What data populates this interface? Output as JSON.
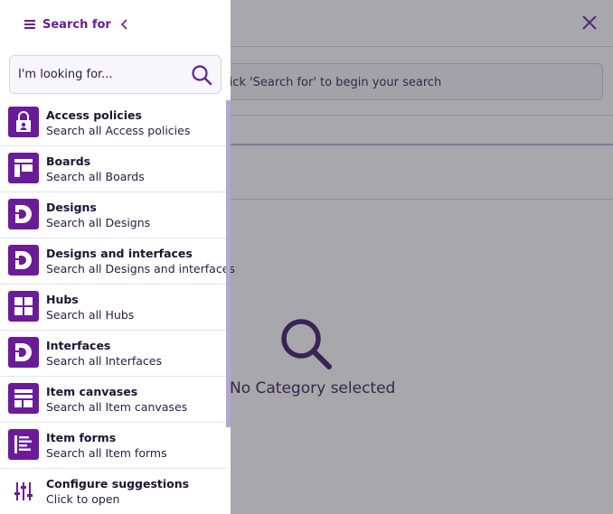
{
  "panel": {
    "title": "Search for",
    "search_placeholder": "I'm looking for..."
  },
  "categories": [
    {
      "title": "Access policies",
      "subtitle": "Search all Access policies",
      "icon": "lock-icon"
    },
    {
      "title": "Boards",
      "subtitle": "Search all Boards",
      "icon": "board-icon"
    },
    {
      "title": "Designs",
      "subtitle": "Search all Designs",
      "icon": "design-icon"
    },
    {
      "title": "Designs and interfaces",
      "subtitle": "Search all Designs and interfaces",
      "icon": "design-icon"
    },
    {
      "title": "Hubs",
      "subtitle": "Search all Hubs",
      "icon": "grid-icon"
    },
    {
      "title": "Interfaces",
      "subtitle": "Search all Interfaces",
      "icon": "design-icon"
    },
    {
      "title": "Item canvases",
      "subtitle": "Search all Item canvases",
      "icon": "canvas-icon"
    },
    {
      "title": "Item forms",
      "subtitle": "Search all Item forms",
      "icon": "form-icon"
    }
  ],
  "configure": {
    "title": "Configure suggestions",
    "subtitle": "Click to open",
    "icon": "sliders-icon"
  },
  "background": {
    "search_hint": "Click 'Search for' to begin your search",
    "empty_state": "No Category selected"
  },
  "colors": {
    "accent": "#6a1b9a",
    "text": "#2b1a45",
    "scrollbar": "#b3a5d6"
  }
}
